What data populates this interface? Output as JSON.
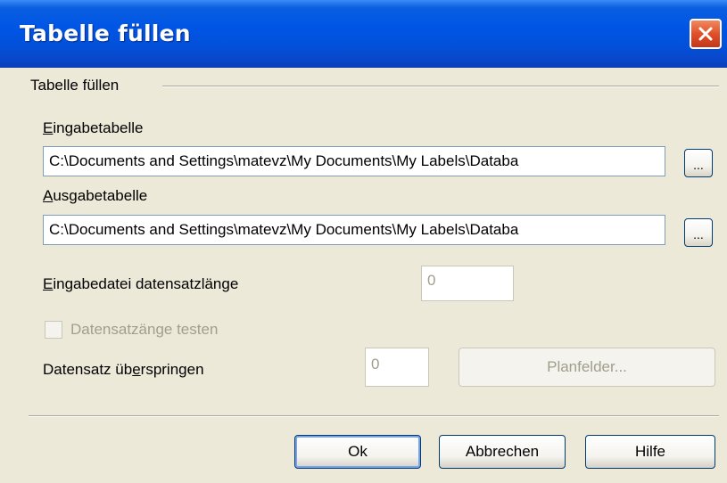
{
  "window": {
    "title": "Tabelle füllen"
  },
  "group": {
    "label": "Tabelle füllen"
  },
  "input_table": {
    "label_first": "E",
    "label_rest": "ingabetabelle",
    "value": "C:\\Documents and Settings\\matevz\\My Documents\\My Labels\\Databa",
    "browse_label": "..."
  },
  "output_table": {
    "label_first": "A",
    "label_rest": "usgabetabelle",
    "value": "C:\\Documents and Settings\\matevz\\My Documents\\My Labels\\Databa",
    "browse_label": "..."
  },
  "record_length": {
    "label_first": "E",
    "label_rest": "ingabedatei datensatzlänge",
    "value": "0"
  },
  "test_record": {
    "label": "Datensatzänge testen",
    "checked": false
  },
  "skip_record": {
    "label_before": "Datensatz üb",
    "label_underlined": "e",
    "label_after": "rspringen",
    "value": "0",
    "button_label": "Planfelder..."
  },
  "buttons": {
    "ok": "Ok",
    "cancel": "Abbrechen",
    "help": "Hilfe"
  },
  "colors": {
    "titlebar": "#0055e5",
    "dialog_background": "#ece9d8",
    "close_button": "#e0502a",
    "disabled_text": "#a19e8c"
  },
  "icons": {
    "close": "close-x-icon"
  }
}
